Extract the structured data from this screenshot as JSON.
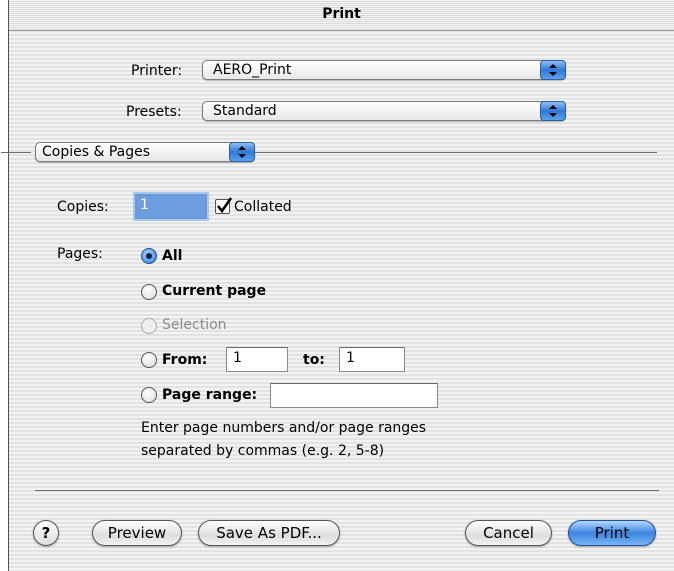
{
  "window": {
    "title": "Print"
  },
  "printer": {
    "label": "Printer:",
    "value": "AERO_Print"
  },
  "presets": {
    "label": "Presets:",
    "value": "Standard"
  },
  "pane": {
    "value": "Copies & Pages"
  },
  "copies": {
    "label": "Copies:",
    "value": "1",
    "collated_label": "Collated",
    "collated": true
  },
  "pages": {
    "label": "Pages:",
    "all_label": "All",
    "current_label": "Current page",
    "selection_label": "Selection",
    "from_label": "From:",
    "from_value": "1",
    "to_label": "to:",
    "to_value": "1",
    "range_label": "Page range:",
    "range_value": "",
    "help_line1": "Enter page numbers and/or page ranges",
    "help_line2": "separated by commas (e.g. 2, 5-8)"
  },
  "buttons": {
    "help": "?",
    "preview": "Preview",
    "save_pdf": "Save As PDF...",
    "cancel": "Cancel",
    "print": "Print"
  },
  "colors": {
    "accent": "#3b84e0",
    "focus": "#6f9ee0"
  }
}
